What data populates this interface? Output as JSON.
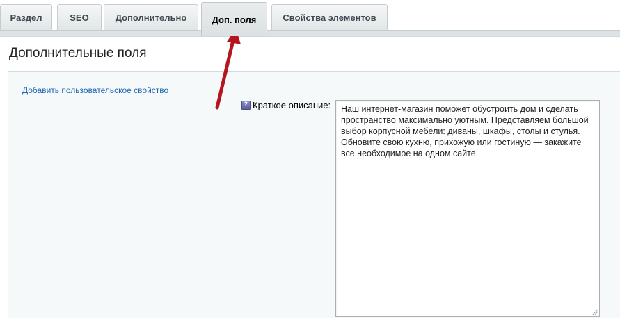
{
  "tabs": [
    {
      "label": "Раздел",
      "active": false
    },
    {
      "label": "SEO",
      "active": false
    },
    {
      "label": "Дополнительно",
      "active": false
    },
    {
      "label": "Доп. поля",
      "active": true
    },
    {
      "label": "Свойства элементов",
      "active": false
    }
  ],
  "page": {
    "title": "Дополнительные поля",
    "add_link": "Добавить пользовательское свойство"
  },
  "field": {
    "help_icon": "question-icon",
    "label": "Краткое описание:",
    "value": "Наш интернет-магазин поможет обустроить дом и сделать пространство максимально уютным. Представляем большой выбор корпусной мебели: диваны, шкафы, столы и стулья. Обновите свою кухню, прихожую или гостиную — закажите все необходимое на одном сайте."
  },
  "annotation": {
    "arrow_color": "#b5161d"
  }
}
